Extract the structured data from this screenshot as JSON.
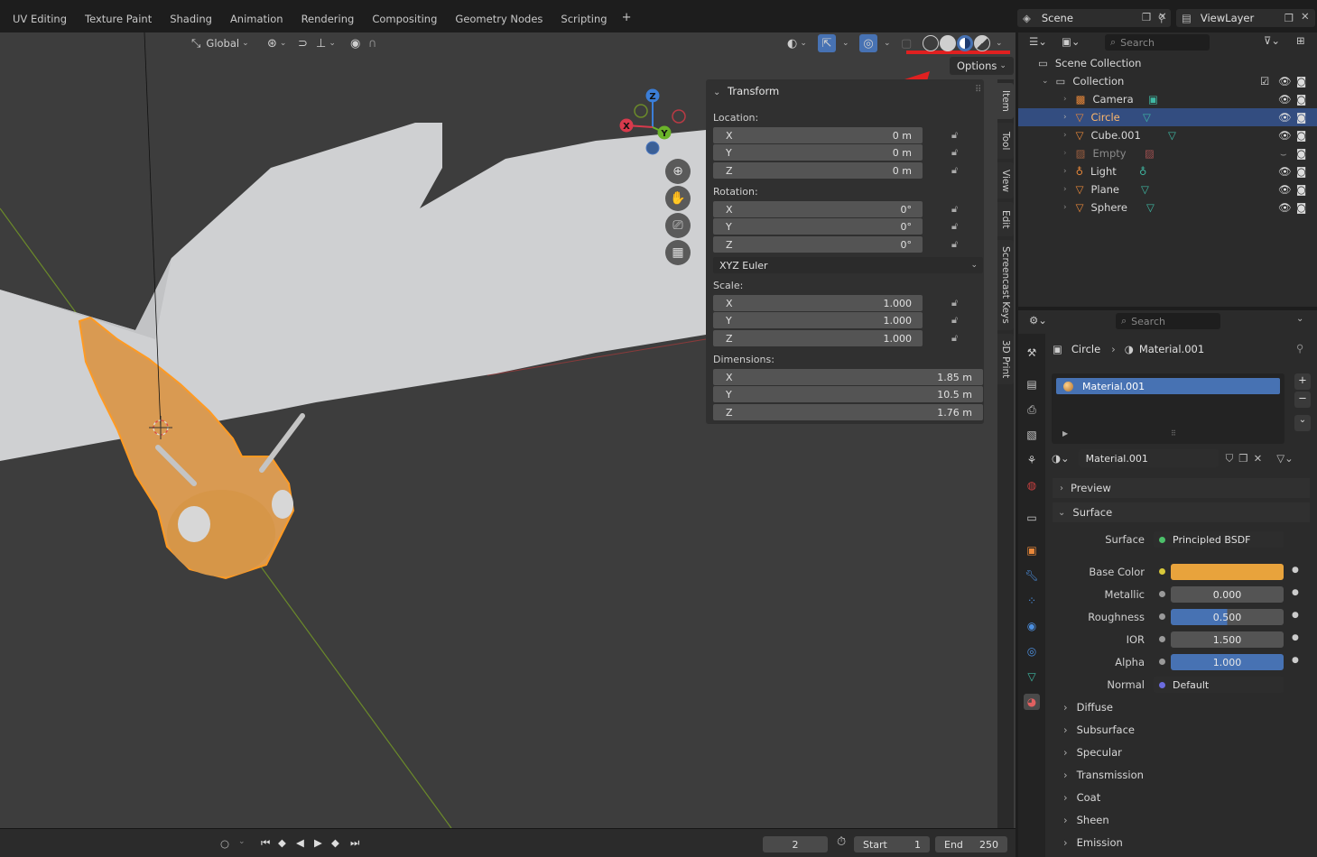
{
  "workspaces": [
    "UV Editing",
    "Texture Paint",
    "Shading",
    "Animation",
    "Rendering",
    "Compositing",
    "Geometry Nodes",
    "Scripting"
  ],
  "viewport": {
    "orientation": "Global",
    "options_label": "Options"
  },
  "transform_panel": {
    "title": "Transform",
    "location_label": "Location:",
    "location": {
      "x": "0 m",
      "y": "0 m",
      "z": "0 m"
    },
    "rotation_label": "Rotation:",
    "rotation": {
      "x": "0°",
      "y": "0°",
      "z": "0°"
    },
    "rotation_mode": "XYZ Euler",
    "scale_label": "Scale:",
    "scale": {
      "x": "1.000",
      "y": "1.000",
      "z": "1.000"
    },
    "dimensions_label": "Dimensions:",
    "dimensions": {
      "x": "1.85 m",
      "y": "10.5 m",
      "z": "1.76 m"
    },
    "axis": {
      "x": "X",
      "y": "Y",
      "z": "Z"
    }
  },
  "side_tabs": [
    "Item",
    "Tool",
    "View",
    "Edit",
    "Screencast Keys",
    "3D Print"
  ],
  "gizmo": {
    "x": "X",
    "y": "Y",
    "z": "Z"
  },
  "timeline": {
    "current_frame": "2",
    "start_label": "Start",
    "start": "1",
    "end_label": "End",
    "end": "250"
  },
  "header_right": {
    "scene": "Scene",
    "view_layer": "ViewLayer"
  },
  "outliner": {
    "search_placeholder": "Search",
    "scene_collection": "Scene Collection",
    "collection": "Collection",
    "items": [
      {
        "name": "Camera",
        "selected": false
      },
      {
        "name": "Circle",
        "selected": true
      },
      {
        "name": "Cube.001",
        "selected": false
      },
      {
        "name": "Empty",
        "selected": false
      },
      {
        "name": "Light",
        "selected": false
      },
      {
        "name": "Plane",
        "selected": false
      },
      {
        "name": "Sphere",
        "selected": false
      }
    ]
  },
  "properties": {
    "search_placeholder": "Search",
    "breadcrumb_object": "Circle",
    "breadcrumb_material": "Material.001",
    "slot_name": "Material.001",
    "material_name": "Material.001",
    "preview_label": "Preview",
    "surface_panel_label": "Surface",
    "surface_label": "Surface",
    "surface_shader": "Principled BSDF",
    "base_color_label": "Base Color",
    "base_color": "#e8a33c",
    "metallic_label": "Metallic",
    "metallic": "0.000",
    "roughness_label": "Roughness",
    "roughness": "0.500",
    "ior_label": "IOR",
    "ior": "1.500",
    "alpha_label": "Alpha",
    "alpha": "1.000",
    "normal_label": "Normal",
    "normal": "Default",
    "subpanels": [
      "Diffuse",
      "Subsurface",
      "Specular",
      "Transmission",
      "Coat",
      "Sheen",
      "Emission"
    ]
  }
}
